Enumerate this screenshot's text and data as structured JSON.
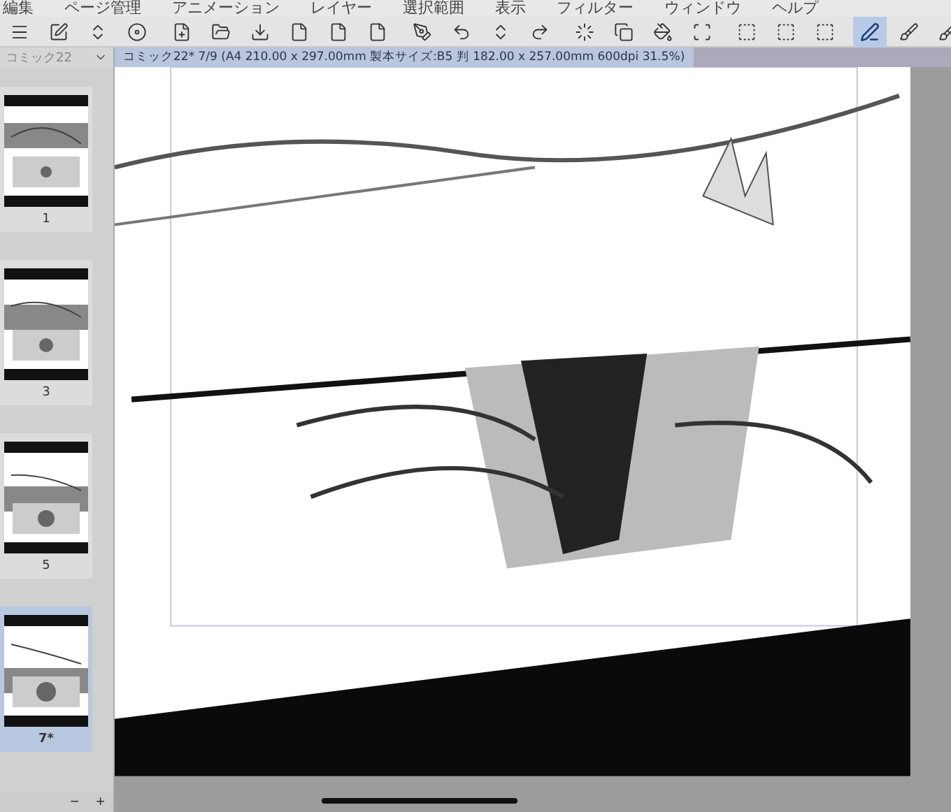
{
  "menu_bar": [
    "編集",
    "ページ管理",
    "アニメーション",
    "レイヤー",
    "選択範囲",
    "表示",
    "フィルター",
    "ウィンドウ",
    "ヘルプ"
  ],
  "toolbar": [
    [
      {
        "kind": "menu",
        "selected": false
      },
      {
        "kind": "edit",
        "selected": false
      },
      {
        "kind": "updown",
        "selected": false
      },
      {
        "kind": "disc",
        "selected": false
      }
    ],
    [
      {
        "kind": "newpage",
        "selected": false
      },
      {
        "kind": "open",
        "selected": false
      },
      {
        "kind": "save",
        "selected": false
      },
      {
        "kind": "file",
        "selected": false
      },
      {
        "kind": "file",
        "selected": false
      },
      {
        "kind": "file",
        "selected": false
      }
    ],
    [
      {
        "kind": "pen",
        "selected": false
      },
      {
        "kind": "undo",
        "selected": false
      },
      {
        "kind": "updown",
        "selected": false
      },
      {
        "kind": "redo",
        "selected": false
      }
    ],
    [
      {
        "kind": "select",
        "selected": false
      },
      {
        "kind": "copy",
        "selected": false
      },
      {
        "kind": "fill",
        "selected": false
      },
      {
        "kind": "crop",
        "selected": false
      }
    ],
    [
      {
        "kind": "dashed",
        "selected": false
      },
      {
        "kind": "dashed",
        "selected": false
      },
      {
        "kind": "dashed",
        "selected": false
      }
    ],
    [
      {
        "kind": "ruler",
        "selected": true
      },
      {
        "kind": "brush",
        "selected": false
      },
      {
        "kind": "brush",
        "selected": false
      }
    ]
  ],
  "page_panel": {
    "title": "コミック22",
    "pages": [
      {
        "label": "1",
        "selected": false
      },
      {
        "label": "3",
        "selected": false
      },
      {
        "label": "5",
        "selected": false
      },
      {
        "label": "7*",
        "selected": true
      }
    ],
    "zoom_out": "−",
    "zoom_in": "+"
  },
  "canvas": {
    "title": "コミック22* 7/9 (A4 210.00 x 297.00mm 製本サイズ:B5 判 182.00 x 257.00mm 600dpi 31.5%)"
  }
}
